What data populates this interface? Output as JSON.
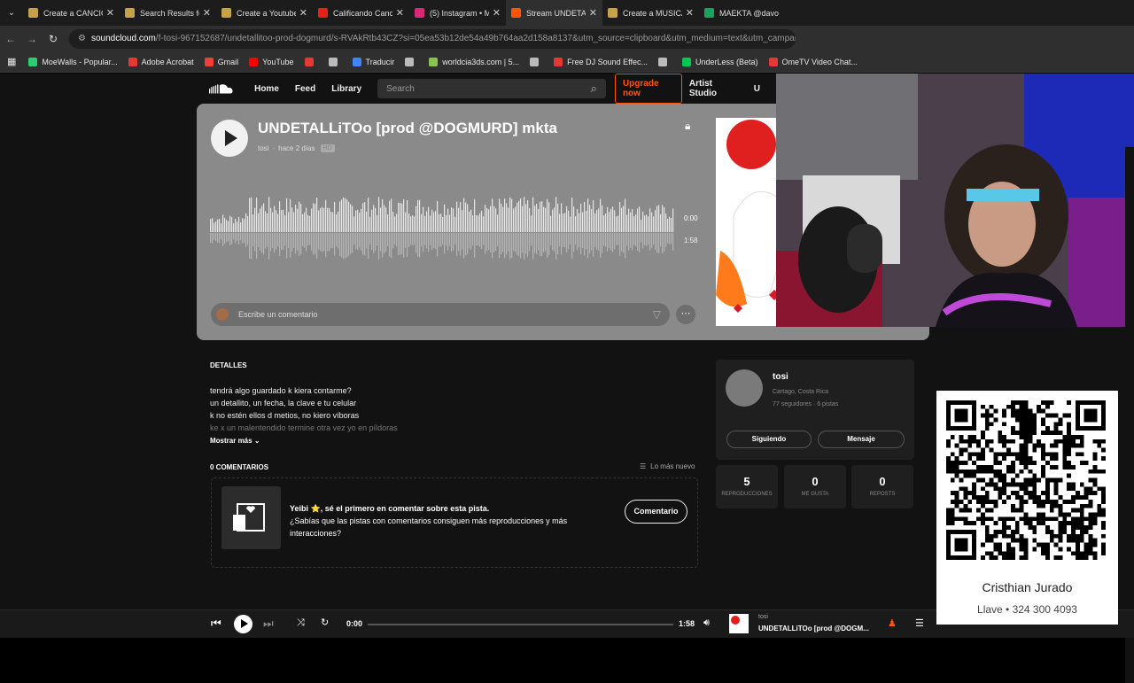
{
  "browser": {
    "tabs": [
      {
        "title": "Create a CANCIÓ",
        "color": "#c6a34a"
      },
      {
        "title": "Search Results fo",
        "color": "#c6a34a"
      },
      {
        "title": "Create a Youtube",
        "color": "#c6a34a"
      },
      {
        "title": "Calificando Canci",
        "color": "#e62117"
      },
      {
        "title": "(5) Instagram • M",
        "color": "#d62976"
      },
      {
        "title": "Stream UNDETAL",
        "color": "#ff5500"
      },
      {
        "title": "Create a MUSICA",
        "color": "#c6a34a"
      },
      {
        "title": "MAEKTA @davo",
        "color": "#1aa260"
      }
    ],
    "url_host": "soundcloud.com",
    "url_path": "/f-tosi-967152687/undetallitoo-prod-dogmurd/s-RVAkRtb43CZ?si=05ea53b12de54a49b764aa2d158a8137&utm_source=clipboard&utm_medium=text&utm_campaign=s",
    "bookmarks": [
      {
        "label": "MoeWalls - Popular...",
        "color": "#2ecc71"
      },
      {
        "label": "Adobe Acrobat",
        "color": "#e53935"
      },
      {
        "label": "Gmail",
        "color": "#ea4335"
      },
      {
        "label": "YouTube",
        "color": "#ff0000"
      },
      {
        "label": "",
        "color": "#e53935"
      },
      {
        "label": "",
        "color": "#bbbbbb"
      },
      {
        "label": "Traducir",
        "color": "#4285f4"
      },
      {
        "label": "",
        "color": "#bbbbbb"
      },
      {
        "label": "worldcia3ds.com | 5...",
        "color": "#8bc34a"
      },
      {
        "label": "",
        "color": "#bbbbbb"
      },
      {
        "label": "Free DJ Sound Effec...",
        "color": "#e53935"
      },
      {
        "label": "",
        "color": "#bbbbbb"
      },
      {
        "label": "UnderLess (Beta)",
        "color": "#00c853"
      },
      {
        "label": "OmeTV Video Chat...",
        "color": "#e53935"
      }
    ]
  },
  "header": {
    "nav": [
      "Home",
      "Feed",
      "Library"
    ],
    "search_placeholder": "Search",
    "upgrade": "Upgrade now",
    "artist_studio": "Artist Studio",
    "extra": "U"
  },
  "track": {
    "title": "UNDETALLiTOo [prod @DOGMURD] mkta",
    "artist": "tosi",
    "time_ago": "hace 2 días",
    "badge": "HD",
    "position": "0:00",
    "duration": "1:58",
    "comment_placeholder": "Escribe un comentario",
    "progress": 0
  },
  "details": {
    "heading": "DETALLES",
    "lines": [
      "tendrá algo guardado k kiera contarme?",
      "un detallito, un fecha, la clave e tu celular",
      "k no estén ellos d metios, no kiero víboras",
      "ke x un malentendido termine otra vez yo en píldoras"
    ],
    "show_more": "Mostrar más"
  },
  "comments": {
    "heading": "0 COMENTARIOS",
    "sort": "Lo más nuevo",
    "prompt_bold": "Yeibi ⭐, sé el primero en comentar sobre esta pista.",
    "prompt_text": "¿Sabías que las pistas con comentarios consiguen más reproducciones y más interacciones?",
    "button": "Comentario"
  },
  "artist_card": {
    "name": "tosi",
    "location": "Cartago, Costa Rica",
    "stats_line": "77 seguidores · 6 pistas",
    "follow": "Siguiendo",
    "message": "Mensaje"
  },
  "stats": [
    {
      "value": "5",
      "label": "REPRODUCCIONES"
    },
    {
      "value": "0",
      "label": "ME GUSTA"
    },
    {
      "value": "0",
      "label": "REPOSTS"
    }
  ],
  "overlay": {
    "name": "Cristhian Jurado",
    "key": "Llave • 324 300 4093"
  },
  "player": {
    "current": "0:00",
    "total": "1:58",
    "artist": "tosi",
    "title": "UNDETALLiTOo [prod @DOGM..."
  }
}
